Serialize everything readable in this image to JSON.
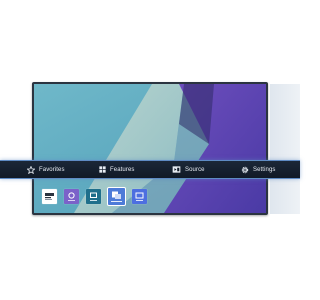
{
  "menu": {
    "items": [
      {
        "id": "favorites",
        "label": "Favorites",
        "icon": "star-icon"
      },
      {
        "id": "features",
        "label": "Features",
        "icon": "grid-icon"
      },
      {
        "id": "source",
        "label": "Source",
        "icon": "input-source-icon"
      },
      {
        "id": "settings",
        "label": "Settings",
        "icon": "gear-icon"
      }
    ],
    "accent_color": "#5e8bc4"
  },
  "apps": [
    {
      "name": "app-tile-1",
      "color": "#ffffff",
      "icon": "magicinfo-icon"
    },
    {
      "name": "app-tile-2",
      "color": "#7b62c9",
      "icon": "app-icon"
    },
    {
      "name": "app-tile-3",
      "color": "#1f6f8b",
      "icon": "app-icon"
    },
    {
      "name": "app-tile-4",
      "color": "#4d7bd8",
      "icon": "app-icon",
      "selected": true
    },
    {
      "name": "app-tile-5",
      "color": "#4d6fe0",
      "icon": "app-icon"
    }
  ]
}
